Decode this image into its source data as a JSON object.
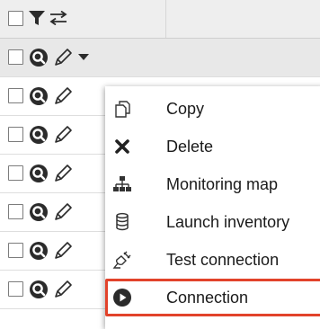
{
  "menu": {
    "items": [
      {
        "label": "Copy",
        "icon": "copy-icon"
      },
      {
        "label": "Delete",
        "icon": "delete-icon"
      },
      {
        "label": "Monitoring map",
        "icon": "sitemap-icon"
      },
      {
        "label": "Launch inventory",
        "icon": "database-icon"
      },
      {
        "label": "Test connection",
        "icon": "plug-icon"
      },
      {
        "label": "Connection",
        "icon": "play-circle-icon",
        "highlighted": true
      }
    ]
  },
  "colors": {
    "header_bg": "#eeeeee",
    "selected_row_bg": "#e8e8e8",
    "highlight_border": "#e2432b",
    "icon": "#2b2b2b"
  }
}
